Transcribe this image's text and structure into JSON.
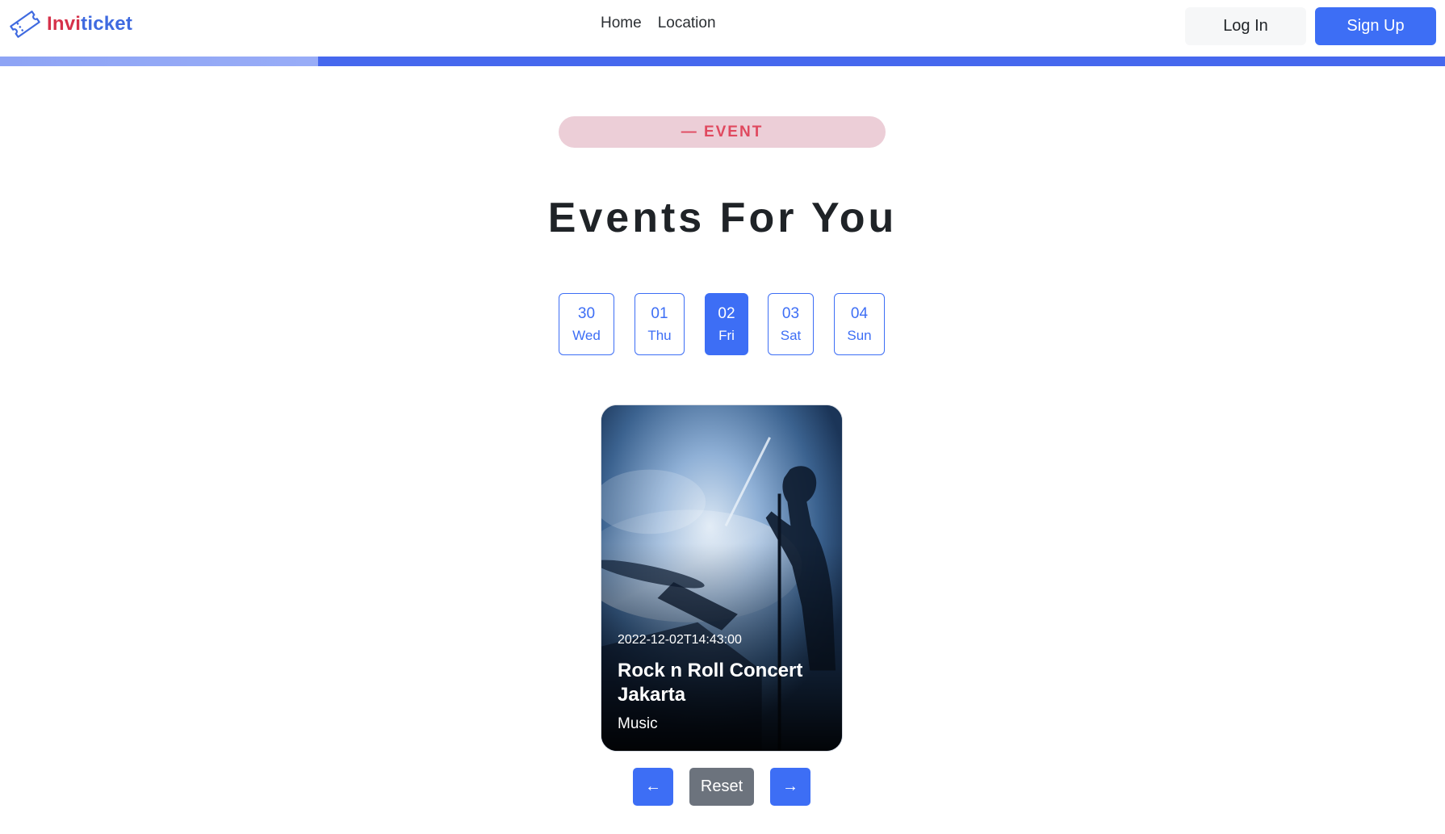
{
  "brand": {
    "name_part1": "Invi",
    "name_part2": "ticket"
  },
  "nav": {
    "links": [
      {
        "label": "Home"
      },
      {
        "label": "Location"
      }
    ],
    "login_label": "Log In",
    "signup_label": "Sign Up"
  },
  "scroll_progress": 0.22,
  "section": {
    "tag": "— EVENT",
    "title": "Events For You"
  },
  "dates": [
    {
      "num": "30",
      "day": "Wed",
      "selected": false
    },
    {
      "num": "01",
      "day": "Thu",
      "selected": false
    },
    {
      "num": "02",
      "day": "Fri",
      "selected": true
    },
    {
      "num": "03",
      "day": "Sat",
      "selected": false
    },
    {
      "num": "04",
      "day": "Sun",
      "selected": false
    }
  ],
  "event_card": {
    "datetime": "2022-12-02T14:43:00",
    "title": "Rock n Roll Concert Jakarta",
    "category": "Music"
  },
  "pager": {
    "prev_label": "←",
    "reset_label": "Reset",
    "next_label": "→"
  },
  "colors": {
    "primary": "#3d6ef5",
    "brand_red": "#d6314a",
    "brand_blue": "#3f6ae0",
    "tag_bg": "#ecced7",
    "tag_text": "#e0495f",
    "secondary_button": "#6c737d"
  },
  "icons": {
    "brand": "ticket-icon"
  }
}
